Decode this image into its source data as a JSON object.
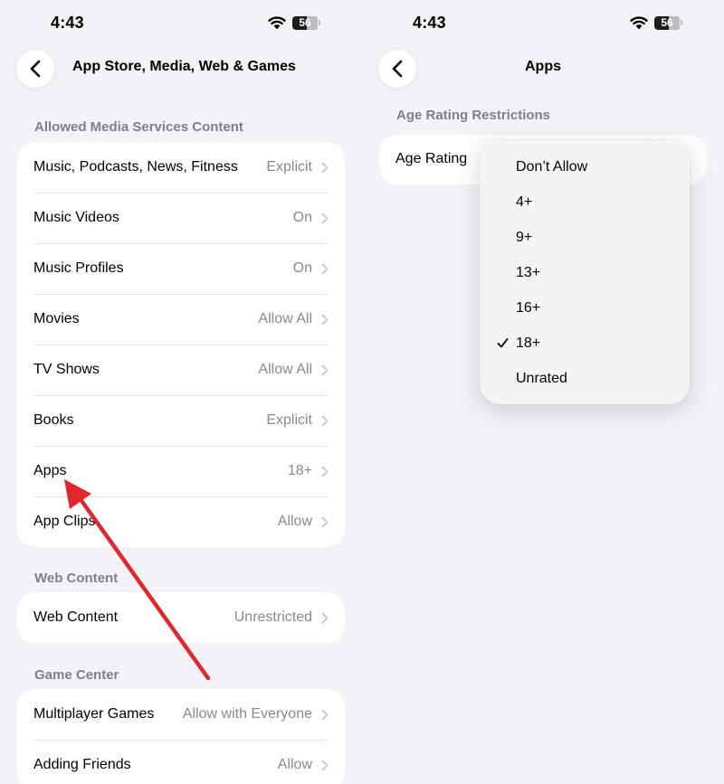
{
  "colors": {
    "background": "#f2f2f7",
    "card": "#ffffff",
    "secondary_text": "#8a8a8e",
    "annotation_arrow": "#e0262f"
  },
  "left_screen": {
    "status": {
      "time": "4:43",
      "battery": "56"
    },
    "nav": {
      "back_icon": "chevron-left-icon",
      "title": "App Store, Media, Web & Games"
    },
    "sections": [
      {
        "header": "Allowed Media Services Content",
        "rows": [
          {
            "label": "Music, Podcasts, News, Fitness",
            "value": "Explicit"
          },
          {
            "label": "Music Videos",
            "value": "On"
          },
          {
            "label": "Music Profiles",
            "value": "On"
          },
          {
            "label": "Movies",
            "value": "Allow All"
          },
          {
            "label": "TV Shows",
            "value": "Allow All"
          },
          {
            "label": "Books",
            "value": "Explicit"
          },
          {
            "label": "Apps",
            "value": "18+"
          },
          {
            "label": "App Clips",
            "value": "Allow"
          }
        ]
      },
      {
        "header": "Web Content",
        "rows": [
          {
            "label": "Web Content",
            "value": "Unrestricted"
          }
        ]
      },
      {
        "header": "Game Center",
        "rows": [
          {
            "label": "Multiplayer Games",
            "value": "Allow with Everyone"
          },
          {
            "label": "Adding Friends",
            "value": "Allow"
          }
        ]
      }
    ]
  },
  "right_screen": {
    "status": {
      "time": "4:43",
      "battery": "56"
    },
    "nav": {
      "back_icon": "chevron-left-icon",
      "title": "Apps"
    },
    "section_header": "Age Rating Restrictions",
    "age_rating_label": "Age Rating",
    "menu": {
      "options": [
        "Don’t Allow",
        "4+",
        "9+",
        "13+",
        "16+",
        "18+",
        "Unrated"
      ],
      "selected": "18+"
    }
  }
}
